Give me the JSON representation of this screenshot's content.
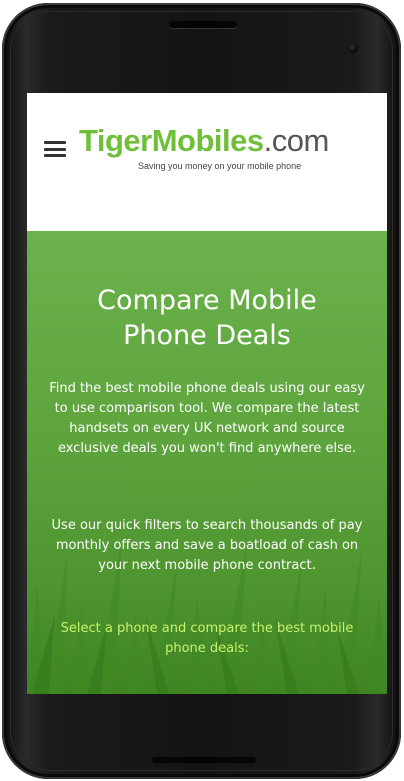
{
  "header": {
    "logo_brand": "TigerMobiles",
    "logo_tld": ".com",
    "tagline": "Saving you money on your mobile phone"
  },
  "hero": {
    "title_line1": "Compare Mobile",
    "title_line2": "Phone Deals",
    "paragraph1": "Find the best mobile phone deals using our easy to use comparison tool. We compare the latest handsets on every UK network and source exclusive deals you won't find anywhere else.",
    "paragraph2": "Use our quick filters to search thousands of pay monthly offers and save a boatload of cash on your next mobile phone contract.",
    "cta": "Select a phone and compare the best mobile phone deals:"
  },
  "colors": {
    "brand_green": "#6fbf3a",
    "hero_green": "#5ea43d",
    "cta_green": "#c8f26c"
  },
  "icons": {
    "menu": "hamburger-icon"
  }
}
